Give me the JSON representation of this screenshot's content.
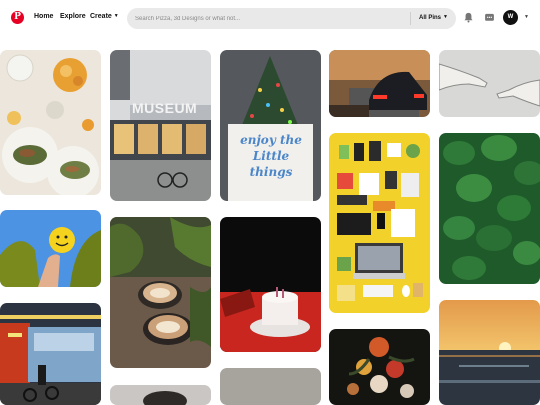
{
  "nav": {
    "logo": "P",
    "home": "Home",
    "explore": "Explore",
    "create": "Create"
  },
  "search": {
    "placeholder": "Search Pizza, 3d Designs or what not...",
    "filter_label": "All Pins"
  },
  "account": {
    "avatar_letter": "W"
  },
  "pins": [
    {
      "name": "food-pin"
    },
    {
      "name": "museum-pin",
      "text": "MUSEUM"
    },
    {
      "name": "christmas-tree-pin",
      "text": "enjoy the Little things"
    },
    {
      "name": "car-street-pin"
    },
    {
      "name": "hands-pin"
    },
    {
      "name": "smiley-balloon-pin"
    },
    {
      "name": "coffee-pin"
    },
    {
      "name": "cake-pin"
    },
    {
      "name": "flatlay-desk-pin"
    },
    {
      "name": "leaves-pin"
    },
    {
      "name": "bus-street-pin"
    },
    {
      "name": "flowers-pin"
    },
    {
      "name": "sunset-sea-pin"
    }
  ],
  "colors": {
    "brand": "#e60023",
    "search_bg": "#e9e9e9"
  }
}
